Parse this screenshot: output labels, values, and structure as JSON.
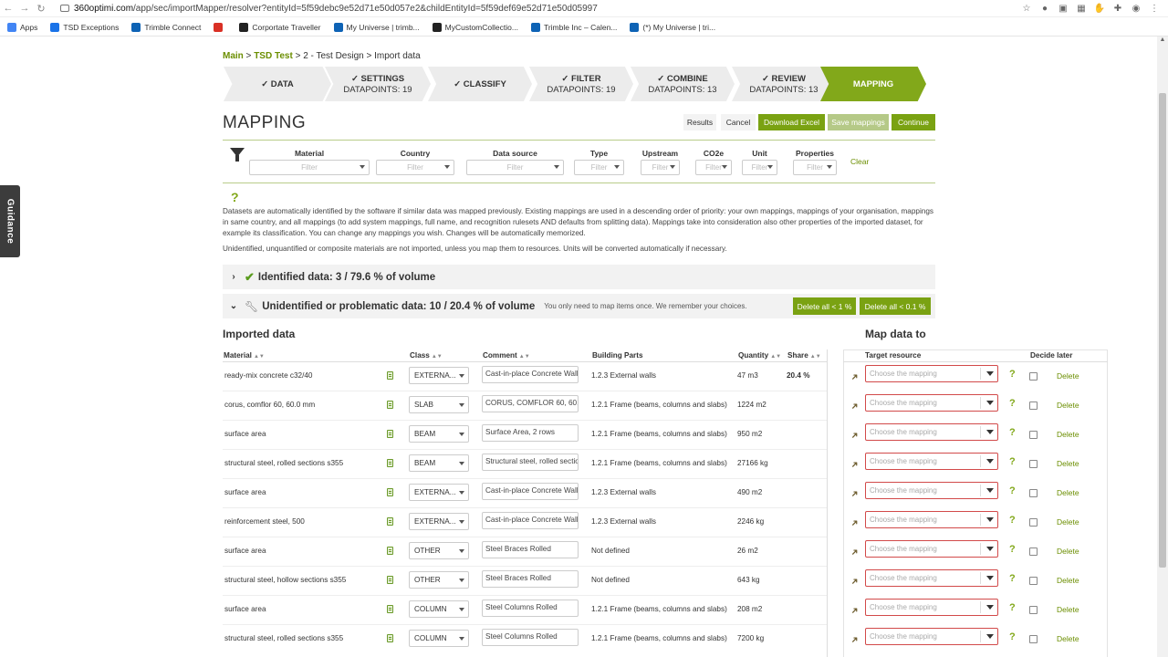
{
  "browser": {
    "url_host": "360optimi.com",
    "url_path": "/app/sec/importMapper/resolver?entityId=5f59debc9e52d71e50d057e2&childEntityId=5f59def69e52d71e50d05997",
    "bookmarks": [
      {
        "label": "Apps",
        "color": "#4285f4"
      },
      {
        "label": "TSD Exceptions",
        "color": "#1a73e8"
      },
      {
        "label": "Trimble Connect",
        "color": "#0e63b5"
      },
      {
        "label": "",
        "color": "#d93025"
      },
      {
        "label": "Corportate Traveller",
        "color": "#222222"
      },
      {
        "label": "My Universe | trimb...",
        "color": "#0e63b5"
      },
      {
        "label": "MyCustomCollectio...",
        "color": "#222222"
      },
      {
        "label": "Trimble Inc – Calen...",
        "color": "#0e63b5"
      },
      {
        "label": "(*) My Universe | tri...",
        "color": "#0e63b5"
      }
    ]
  },
  "guidance_label": "Guidance",
  "breadcrumb": {
    "main": "Main",
    "sep1": " > ",
    "project": "TSD Test",
    "sep2": " > ",
    "design": "2 - Test Design",
    "sep3": " > ",
    "current": "Import data"
  },
  "steps": [
    {
      "title": "✓ DATA",
      "sub": ""
    },
    {
      "title": "✓ SETTINGS",
      "sub": "DATAPOINTS: 19"
    },
    {
      "title": "✓ CLASSIFY",
      "sub": ""
    },
    {
      "title": "✓ FILTER",
      "sub": "DATAPOINTS: 19"
    },
    {
      "title": "✓ COMBINE",
      "sub": "DATAPOINTS: 13"
    },
    {
      "title": "✓ REVIEW",
      "sub": "DATAPOINTS: 13"
    },
    {
      "title": "MAPPING",
      "sub": ""
    }
  ],
  "page_title": "MAPPING",
  "buttons": {
    "results": "Results",
    "cancel": "Cancel",
    "download_excel": "Download Excel",
    "save_mappings": "Save mappings",
    "continue": "Continue"
  },
  "filters": [
    {
      "label": "Material",
      "placeholder": "Filter"
    },
    {
      "label": "Country",
      "placeholder": "Filter"
    },
    {
      "label": "Data source",
      "placeholder": "Filter"
    },
    {
      "label": "Type",
      "placeholder": "Filter"
    },
    {
      "label": "Upstream",
      "placeholder": "Filter"
    },
    {
      "label": "CO2e",
      "placeholder": "Filter"
    },
    {
      "label": "Unit",
      "placeholder": "Filter"
    },
    {
      "label": "Properties",
      "placeholder": "Filter"
    }
  ],
  "clear_label": "Clear",
  "info_text": "Datasets are automatically identified by the software if similar data was mapped previously. Existing mappings are used in a descending order of priority: your own mappings, mappings of your organisation, mappings in same country, and all mappings (to add system mappings, full name, and recognition rulesets AND defaults from splitting data). Mappings take into consideration also other properties of the imported dataset, for example its classification. You can change any mappings you wish. Changes will be automatically memorized.",
  "info_text2": "Unidentified, unquantified or composite materials are not imported, unless you map them to resources. Units will be converted automatically if necessary.",
  "identified": {
    "label": "Identified data: 3 / 79.6 % of volume"
  },
  "unidentified": {
    "label": "Unidentified or problematic data: 10 / 20.4 % of volume",
    "note": "You only need to map items once. We remember your choices.",
    "delete_1": "Delete all < 1 %",
    "delete_01": "Delete all < 0.1 %"
  },
  "imported_heading": "Imported data",
  "map_heading": "Map data to",
  "columns": {
    "material": "Material",
    "class": "Class",
    "comment": "Comment",
    "building_parts": "Building Parts",
    "quantity": "Quantity",
    "share": "Share",
    "target": "Target resource",
    "decide_later": "Decide later"
  },
  "map_placeholder": "Choose the mapping",
  "delete_label": "Delete",
  "rows": [
    {
      "material": "ready-mix concrete c32/40",
      "class": "EXTERNA...",
      "comment": "Cast-in-place Concrete Wall",
      "parts": "1.2.3 External walls",
      "quantity": "47 m3",
      "share": "20.4 %"
    },
    {
      "material": "corus, comflor 60, 60.0 mm",
      "class": "SLAB",
      "comment": "CORUS, COMFLOR 60, 60.0",
      "parts": "1.2.1 Frame (beams, columns and slabs)",
      "quantity": "1224 m2",
      "share": ""
    },
    {
      "material": "surface area",
      "class": "BEAM",
      "comment": "Surface Area, 2 rows",
      "parts": "1.2.1 Frame (beams, columns and slabs)",
      "quantity": "950 m2",
      "share": ""
    },
    {
      "material": "structural steel, rolled sections s355",
      "class": "BEAM",
      "comment": "Structural steel, rolled sections",
      "parts": "1.2.1 Frame (beams, columns and slabs)",
      "quantity": "27166 kg",
      "share": ""
    },
    {
      "material": "surface area",
      "class": "EXTERNA...",
      "comment": "Cast-in-place Concrete Wall",
      "parts": "1.2.3 External walls",
      "quantity": "490 m2",
      "share": ""
    },
    {
      "material": "reinforcement steel, 500",
      "class": "EXTERNA...",
      "comment": "Cast-in-place Concrete Wall",
      "parts": "1.2.3 External walls",
      "quantity": "2246 kg",
      "share": ""
    },
    {
      "material": "surface area",
      "class": "OTHER",
      "comment": "Steel Braces Rolled",
      "parts": "Not defined",
      "quantity": "26 m2",
      "share": ""
    },
    {
      "material": "structural steel, hollow sections s355",
      "class": "OTHER",
      "comment": "Steel Braces Rolled",
      "parts": "Not defined",
      "quantity": "643 kg",
      "share": ""
    },
    {
      "material": "surface area",
      "class": "COLUMN",
      "comment": "Steel Columns Rolled",
      "parts": "1.2.1 Frame (beams, columns and slabs)",
      "quantity": "208 m2",
      "share": ""
    },
    {
      "material": "structural steel, rolled sections s355",
      "class": "COLUMN",
      "comment": "Steel Columns Rolled",
      "parts": "1.2.1 Frame (beams, columns and slabs)",
      "quantity": "7200 kg",
      "share": ""
    }
  ],
  "colors": {
    "accent_green": "#82a81a",
    "button_green": "#7aa212",
    "link_green": "#6b8e00",
    "error_red": "#d24a4a"
  }
}
